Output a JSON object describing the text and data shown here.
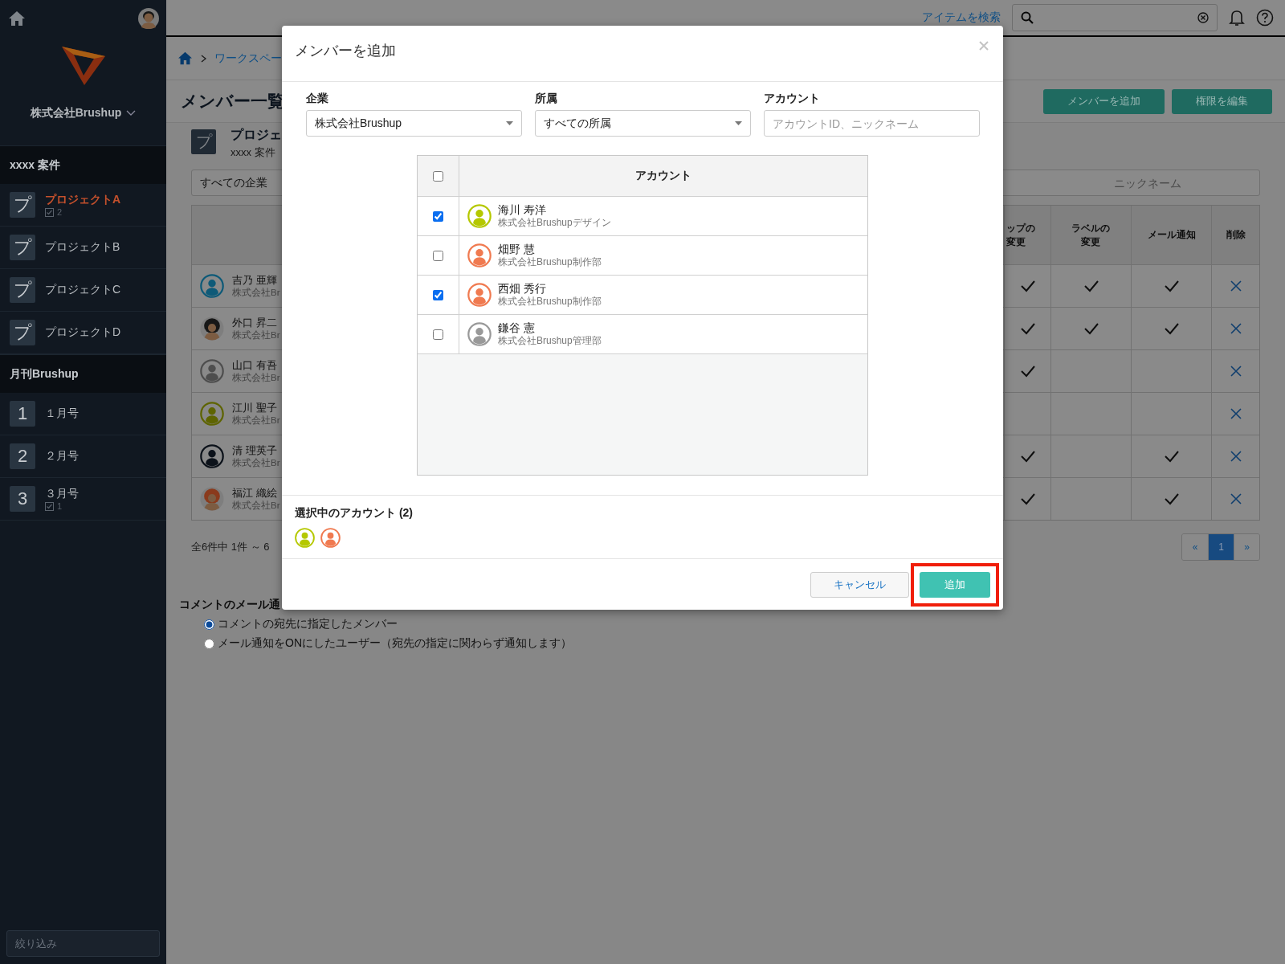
{
  "sidebar": {
    "company": "株式会社Brushup",
    "groups": [
      {
        "title": "xxxx 案件",
        "items": [
          {
            "icon": "プ",
            "label": "プロジェクトA",
            "selected": true,
            "count": "2"
          },
          {
            "icon": "プ",
            "label": "プロジェクトB",
            "selected": false
          },
          {
            "icon": "プ",
            "label": "プロジェクトC",
            "selected": false
          },
          {
            "icon": "プ",
            "label": "プロジェクトD",
            "selected": false
          }
        ]
      },
      {
        "title": "月刊Brushup",
        "items": [
          {
            "icon": "1",
            "label": "１月号",
            "selected": false
          },
          {
            "icon": "2",
            "label": "２月号",
            "selected": false
          },
          {
            "icon": "3",
            "label": "３月号",
            "selected": false,
            "count": "1"
          }
        ]
      }
    ],
    "filter_placeholder": "絞り込み"
  },
  "topbar": {
    "search_link": "アイテムを検索"
  },
  "breadcrumb": {
    "items": [
      "ワークスペー"
    ]
  },
  "page": {
    "title": "メンバー一覧",
    "actions": [
      "メンバーを追加",
      "権限を編集"
    ]
  },
  "project": {
    "icon": "プ",
    "name": "プロジェ",
    "group": "xxxx 案件"
  },
  "filters": {
    "company": "すべての企業",
    "search_placeholder": "ニックネーム"
  },
  "member_table": {
    "columns": [
      "ップの変更",
      "ラベルの変更",
      "メール通知",
      "削除"
    ],
    "rows": [
      {
        "name": "吉乃 亜輝",
        "company": "株式会社Br",
        "avatar": {
          "kind": "outline",
          "color": "#0e5a78"
        },
        "membership_change": true,
        "label_change": true,
        "mail_notification": true
      },
      {
        "name": "外口 昇二",
        "company": "株式会社Br",
        "avatar": {
          "kind": "illustration",
          "color": "#171717"
        },
        "membership_change": true,
        "label_change": true,
        "mail_notification": true
      },
      {
        "name": "山口 有吾",
        "company": "株式会社Br",
        "avatar": {
          "kind": "outline",
          "color": "#4e4e4e"
        },
        "membership_change": true,
        "label_change": false,
        "mail_notification": false
      },
      {
        "name": "江川 聖子",
        "company": "株式会社Br",
        "avatar": {
          "kind": "outline",
          "color": "#5e6400"
        },
        "membership_change": false,
        "label_change": false,
        "mail_notification": false
      },
      {
        "name": "清 理英子",
        "company": "株式会社Br",
        "avatar": {
          "kind": "outline",
          "color": "#0c121a"
        },
        "membership_change": true,
        "label_change": false,
        "mail_notification": true
      },
      {
        "name": "福江 織絵",
        "company": "株式会社Br",
        "avatar": {
          "kind": "illustration",
          "color": "#8a3a1c"
        },
        "membership_change": true,
        "label_change": false,
        "mail_notification": true
      }
    ]
  },
  "pagination": {
    "summary": "全6件中 1件 ～ 6",
    "pages": [
      {
        "label": "«",
        "selected": false
      },
      {
        "label": "1",
        "selected": true
      },
      {
        "label": "»",
        "selected": false
      }
    ]
  },
  "comment_mail": {
    "title": "コメントのメール通",
    "options": [
      {
        "label": "コメントの宛先に指定したメンバー",
        "selected": true
      },
      {
        "label": "メール通知をONにしたユーザー（宛先の指定に関わらず通知します）",
        "selected": false
      }
    ]
  },
  "modal": {
    "title": "メンバーを追加",
    "fields": [
      {
        "label": "企業",
        "kind": "select",
        "value": "株式会社Brushup"
      },
      {
        "label": "所属",
        "kind": "select",
        "value": "すべての所属"
      },
      {
        "label": "アカウント",
        "kind": "text",
        "placeholder": "アカウントID、ニックネーム"
      }
    ],
    "table": {
      "header_checked": false,
      "column": "アカウント",
      "rows": [
        {
          "name": "海川 寿洋",
          "department": "株式会社Brushupデザイン",
          "checked": true,
          "avatar": {
            "kind": "outline",
            "color": "#b5c800"
          }
        },
        {
          "name": "畑野 慧",
          "department": "株式会社Brushup制作部",
          "checked": false,
          "avatar": {
            "kind": "outline",
            "color": "#f07a50"
          }
        },
        {
          "name": "西畑 秀行",
          "department": "株式会社Brushup制作部",
          "checked": true,
          "avatar": {
            "kind": "outline",
            "color": "#f07a50"
          }
        },
        {
          "name": "鎌谷 憲",
          "department": "株式会社Brushup管理部",
          "checked": false,
          "avatar": {
            "kind": "outline",
            "color": "#999999"
          }
        }
      ]
    },
    "selected_title": "選択中のアカウント (2)",
    "selected_accounts": [
      {
        "kind": "outline",
        "color": "#b5c800"
      },
      {
        "kind": "outline",
        "color": "#f07a50"
      }
    ],
    "buttons": [
      {
        "label": "キャンセル",
        "kind": "secondary",
        "highlighted": false
      },
      {
        "label": "追加",
        "kind": "primary",
        "highlighted": true
      }
    ]
  }
}
